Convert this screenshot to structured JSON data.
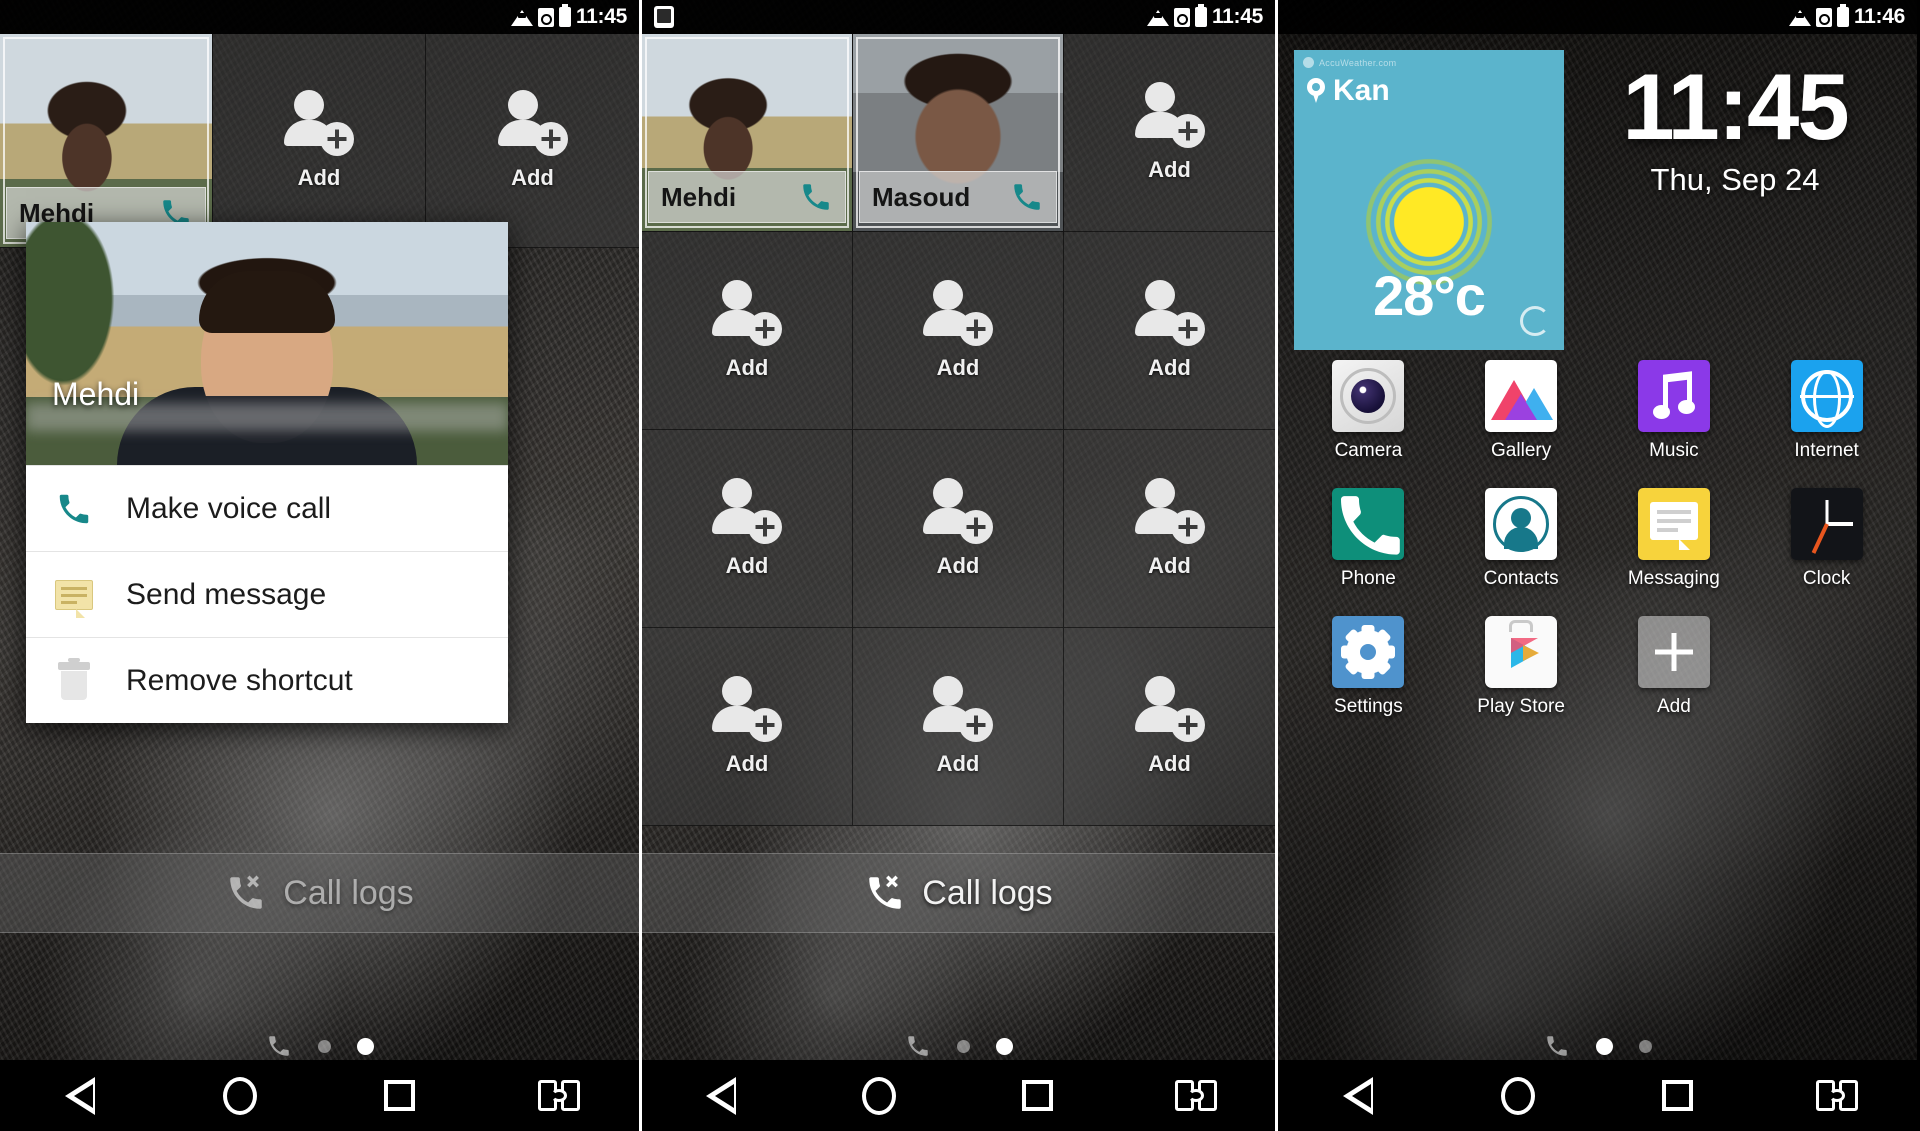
{
  "panels": [
    {
      "id": "panel-contacts-popup",
      "statusbar": {
        "time": "11:45",
        "icons": [
          "wifi-icon",
          "sd-card-icon",
          "battery-icon"
        ],
        "left_icons": []
      },
      "widget_cells": [
        {
          "type": "contact",
          "name": "Mehdi",
          "selected": true
        },
        {
          "type": "add",
          "label": "Add"
        },
        {
          "type": "add",
          "label": "Add"
        }
      ],
      "popup": {
        "contact_name": "Mehdi",
        "items": [
          {
            "icon": "phone-icon",
            "label": "Make voice call"
          },
          {
            "icon": "message-icon",
            "label": "Send message"
          },
          {
            "icon": "trash-icon",
            "label": "Remove shortcut"
          }
        ]
      },
      "call_logs_label": "Call logs",
      "page_dots": {
        "count": 3,
        "active": 2
      }
    },
    {
      "id": "panel-contacts-grid",
      "statusbar": {
        "time": "11:45",
        "icons": [
          "wifi-icon",
          "sd-card-icon",
          "battery-icon"
        ],
        "left_icons": [
          "screenshot-icon"
        ]
      },
      "widget_cells": [
        {
          "type": "contact",
          "name": "Mehdi",
          "selected": true
        },
        {
          "type": "contact",
          "name": "Masoud",
          "selected": true
        },
        {
          "type": "add",
          "label": "Add"
        },
        {
          "type": "add",
          "label": "Add"
        },
        {
          "type": "add",
          "label": "Add"
        },
        {
          "type": "add",
          "label": "Add"
        },
        {
          "type": "add",
          "label": "Add"
        },
        {
          "type": "add",
          "label": "Add"
        },
        {
          "type": "add",
          "label": "Add"
        },
        {
          "type": "add",
          "label": "Add"
        },
        {
          "type": "add",
          "label": "Add"
        },
        {
          "type": "add",
          "label": "Add"
        }
      ],
      "call_logs_label": "Call logs",
      "page_dots": {
        "count": 3,
        "active": 2
      }
    },
    {
      "id": "panel-home-screen",
      "statusbar": {
        "time": "11:46",
        "icons": [
          "wifi-icon",
          "sd-card-icon",
          "battery-icon"
        ],
        "left_icons": []
      },
      "weather": {
        "brand": "AccuWeather.com",
        "location": "Kan",
        "temperature": "28°c",
        "condition_icon": "sun-icon",
        "refresh_icon": "refresh-icon",
        "bg_color": "#5bb4cc",
        "sun_color": "#ffe925"
      },
      "clock": {
        "time": "11:45",
        "date": "Thu, Sep 24"
      },
      "apps": [
        [
          {
            "label": "Camera",
            "icon": "camera-icon"
          },
          {
            "label": "Gallery",
            "icon": "gallery-icon"
          },
          {
            "label": "Music",
            "icon": "music-icon"
          },
          {
            "label": "Internet",
            "icon": "internet-icon"
          }
        ],
        [
          {
            "label": "Phone",
            "icon": "phone-icon"
          },
          {
            "label": "Contacts",
            "icon": "contacts-icon"
          },
          {
            "label": "Messaging",
            "icon": "messaging-icon"
          },
          {
            "label": "Clock",
            "icon": "clock-icon"
          }
        ],
        [
          {
            "label": "Settings",
            "icon": "settings-icon"
          },
          {
            "label": "Play Store",
            "icon": "play-store-icon"
          },
          {
            "label": "Add",
            "icon": "plus-icon"
          }
        ]
      ],
      "page_dots": {
        "count": 2,
        "active": 1
      }
    }
  ],
  "navbar": {
    "buttons": [
      "back-icon",
      "home-icon",
      "recents-icon",
      "dual-window-icon"
    ]
  },
  "colors": {
    "accent_teal": "#17888a",
    "weather_blue": "#5bb4cc",
    "sun_yellow": "#ffe925",
    "messaging_yellow": "#f7d33c",
    "music_purple": "#8b39e8",
    "internet_blue": "#1ba2ee",
    "settings_blue": "#4f93cd",
    "phone_green": "#0e8f7a"
  }
}
